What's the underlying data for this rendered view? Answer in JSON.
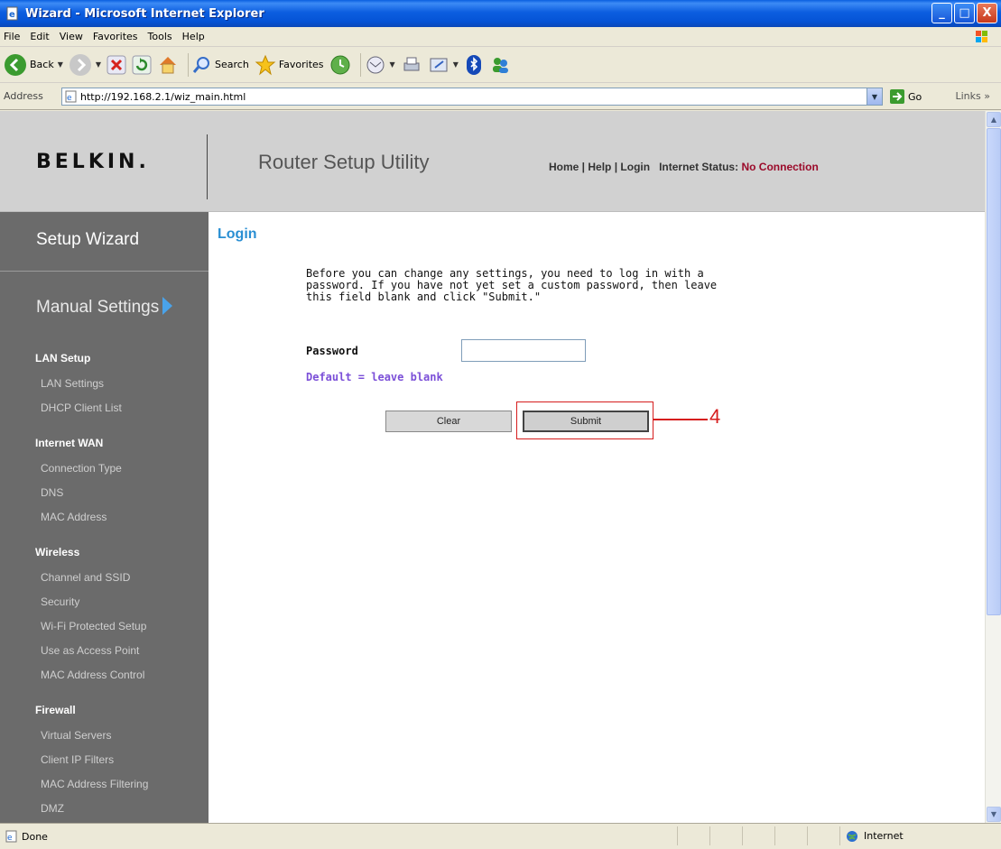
{
  "window": {
    "title": "Wizard - Microsoft Internet Explorer",
    "controls": {
      "minimize": "_",
      "maximize": "□",
      "close": "X"
    }
  },
  "menu": [
    "File",
    "Edit",
    "View",
    "Favorites",
    "Tools",
    "Help"
  ],
  "toolbar": {
    "back_label": "Back",
    "search_label": "Search",
    "favorites_label": "Favorites"
  },
  "address": {
    "label": "Address",
    "url": "http://192.168.2.1/wiz_main.html",
    "go_label": "Go",
    "links_label": "Links"
  },
  "header": {
    "logo": "BELKIN.",
    "title": "Router Setup Utility",
    "nav": {
      "home": "Home",
      "help": "Help",
      "login": "Login",
      "internet_status_label": "Internet Status:",
      "internet_status_value": "No Connection"
    }
  },
  "sidebar": {
    "wizard": "Setup Wizard",
    "manual": "Manual Settings",
    "sections": [
      {
        "title": "LAN Setup",
        "items": [
          "LAN Settings",
          "DHCP Client List"
        ]
      },
      {
        "title": "Internet WAN",
        "items": [
          "Connection Type",
          "DNS",
          "MAC Address"
        ]
      },
      {
        "title": "Wireless",
        "items": [
          "Channel and SSID",
          "Security",
          "Wi-Fi Protected Setup",
          "Use as Access Point",
          "MAC Address Control"
        ]
      },
      {
        "title": "Firewall",
        "items": [
          "Virtual Servers",
          "Client IP Filters",
          "MAC Address Filtering",
          "DMZ"
        ]
      }
    ]
  },
  "main": {
    "title": "Login",
    "intro_lines": [
      "Before you can change any settings, you need to log in with a",
      "password. If you have not yet set a custom password, then leave",
      "this field blank and click \"Submit.\""
    ],
    "password_label": "Password",
    "password_value": "",
    "password_hint": "Default = leave blank",
    "clear_label": "Clear",
    "submit_label": "Submit",
    "callout_number": "4",
    "callout_color": "#d61d1d"
  },
  "status": {
    "text": "Done",
    "zone": "Internet"
  },
  "colors": {
    "accent_blue": "#2a8fd3",
    "status_red": "#9b0a2a",
    "hint_purple": "#7b4fd8",
    "sidebar_bg": "#6b6b6b",
    "header_bg": "#d1d1d1"
  }
}
